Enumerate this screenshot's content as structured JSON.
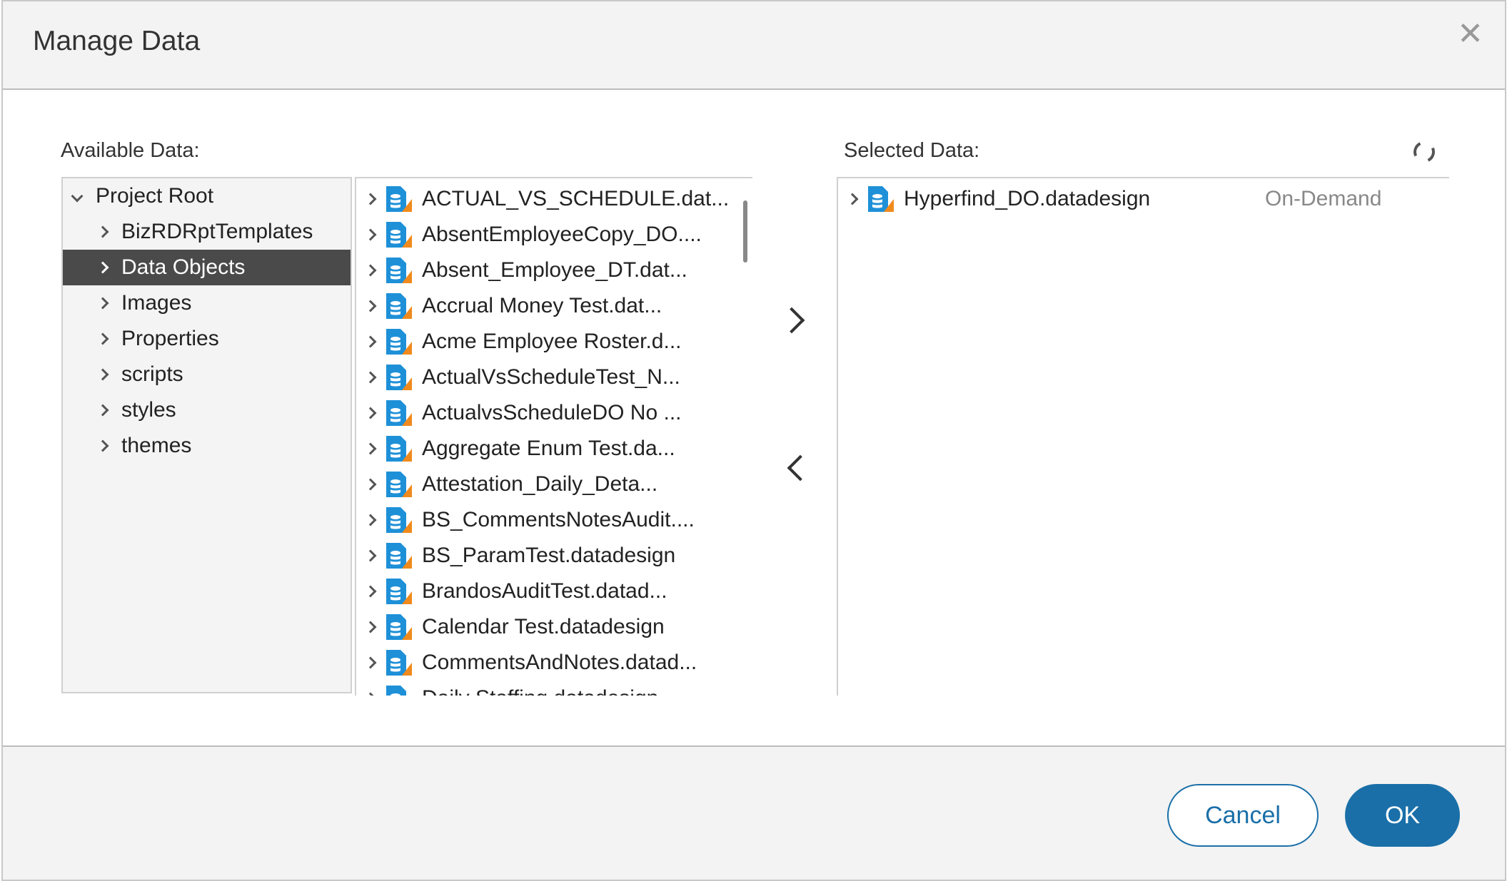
{
  "dialog": {
    "title": "Manage Data",
    "close_icon": "close-icon"
  },
  "available": {
    "label": "Available Data:",
    "tree": [
      {
        "label": "Project Root",
        "expanded": true,
        "level": 0
      },
      {
        "label": "BizRDRptTemplates",
        "level": 1
      },
      {
        "label": "Data Objects",
        "level": 1,
        "selected": true
      },
      {
        "label": "Images",
        "level": 1
      },
      {
        "label": "Properties",
        "level": 1
      },
      {
        "label": "scripts",
        "level": 1
      },
      {
        "label": "styles",
        "level": 1
      },
      {
        "label": "themes",
        "level": 1
      }
    ],
    "items": [
      "ACTUAL_VS_SCHEDULE.dat...",
      "AbsentEmployeeCopy_DO....",
      "Absent_Employee_DT.dat...",
      "Accrual Money Test.dat...",
      "Acme Employee Roster.d...",
      "ActualVsScheduleTest_N...",
      "ActualvsScheduleDO No ...",
      "Aggregate Enum Test.da...",
      "Attestation_Daily_Deta...",
      "BS_CommentsNotesAudit....",
      "BS_ParamTest.datadesign",
      "BrandosAuditTest.datad...",
      "Calendar Test.datadesign",
      "CommentsAndNotes.datad...",
      "Daily Staffing.datadesign"
    ]
  },
  "selected": {
    "label": "Selected Data:",
    "items": [
      {
        "name": "Hyperfind_DO.datadesign",
        "status": "On-Demand"
      }
    ]
  },
  "footer": {
    "cancel": "Cancel",
    "ok": "OK"
  },
  "colors": {
    "accent": "#1a6fa8",
    "selected_row": "#4a4a4a",
    "icon_blue": "#1e90d8",
    "icon_orange": "#f08a1c"
  }
}
